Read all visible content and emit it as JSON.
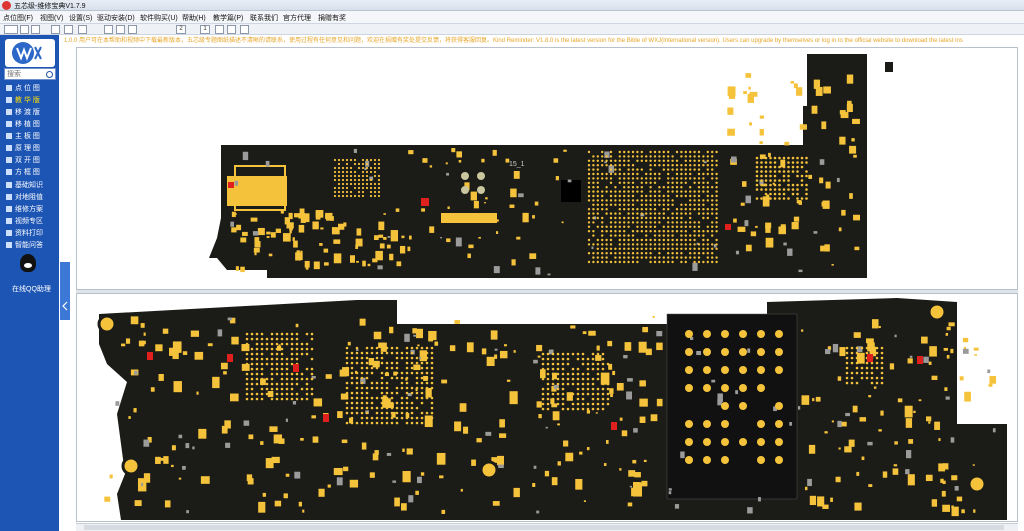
{
  "window": {
    "title": "五芯级-维修宝典V1.7.9"
  },
  "menu": [
    "点位图(F)",
    "视图(V)",
    "设置(S)",
    "驱动安装(D)",
    "软件购买(U)",
    "帮助(H)",
    "教学篇(P)",
    "联系我们",
    "官方代理",
    "捐赠有奖"
  ],
  "toolbar": {
    "page_label": "2",
    "zoom_label": "1"
  },
  "search": {
    "placeholder": "搜索"
  },
  "sidebar": {
    "items": [
      {
        "label": "点 位 图",
        "active": false
      },
      {
        "label": "教 华 版",
        "active": true
      },
      {
        "label": "移 渡 版",
        "active": false
      },
      {
        "label": "移 植 图",
        "active": false
      },
      {
        "label": "主 板 图",
        "active": false
      },
      {
        "label": "原 理 图",
        "active": false
      },
      {
        "label": "双 开 图",
        "active": false
      },
      {
        "label": "方 框 图",
        "active": false
      },
      {
        "label": "基础知识",
        "active": false
      },
      {
        "label": "对地阻值",
        "active": false
      },
      {
        "label": "维修方案",
        "active": false
      },
      {
        "label": "视频专区",
        "active": false
      },
      {
        "label": "资料打印",
        "active": false
      },
      {
        "label": "智能问答",
        "active": false
      }
    ],
    "qq_label": "在线QQ助理"
  },
  "notice": "1.0.0  用户可在本帮助和视频中下载最新版本，五芯级专题图纸描述不清晰的请联系，使用过程有任何意见和问题，欢迎在捐赠有奖处提交反馈，将获得客服回复。Kind Reminder:  V1.8.0 is the latest version for the Bible of WXJ(International version). Users can upgrade by themselves or log in to the official website to download the latest ins",
  "board_top": {
    "label": "15_1"
  },
  "colors": {
    "board": "#1b1b17",
    "pad": "#f5c33b",
    "sidebar": "#1d55b5",
    "accent_red": "#e0201c",
    "grey_pad": "#9b9b9b"
  }
}
